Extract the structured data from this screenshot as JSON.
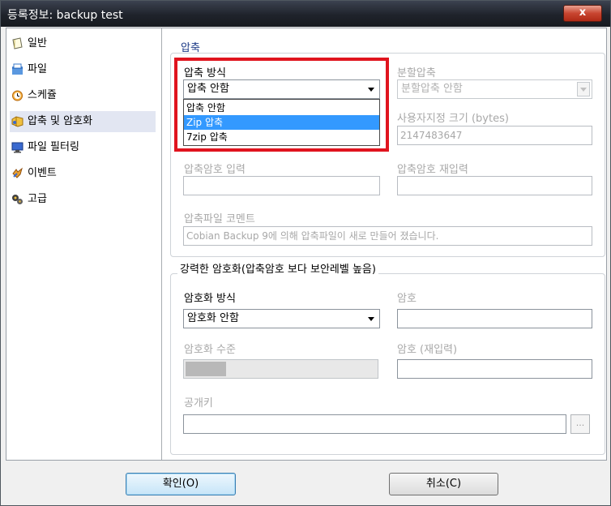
{
  "window": {
    "title": "등록정보: backup test",
    "close_label": "x"
  },
  "sidebar": {
    "items": [
      {
        "label": "일반",
        "icon": "general-page-icon"
      },
      {
        "label": "파일",
        "icon": "file-icon"
      },
      {
        "label": "스케쥴",
        "icon": "clock-icon"
      },
      {
        "label": "압축 및 암호화",
        "icon": "compression-icon",
        "selected": true
      },
      {
        "label": "파일 필터링",
        "icon": "monitor-icon"
      },
      {
        "label": "이벤트",
        "icon": "event-icon"
      },
      {
        "label": "고급",
        "icon": "advanced-icon"
      }
    ]
  },
  "compression": {
    "group_label": "압축",
    "method_label": "압축 방식",
    "method_value": "압축 안함",
    "method_options": [
      "압축 안함",
      "Zip 압축",
      "7zip 압축"
    ],
    "highlighted_option": "Zip 압축",
    "split_label": "분할압축",
    "split_value": "분할압축 안함",
    "custom_size_label": "사용자지정 크기 (bytes)",
    "custom_size_value": "2147483647",
    "password_label": "압축암호 입력",
    "password_confirm_label": "압축암호 재입력",
    "comment_label": "압축파일 코멘트",
    "comment_value": "Cobian Backup 9에 의해 압축파일이 새로 만들어 졌습니다."
  },
  "encryption": {
    "group_label": "강력한 암호화(압축암호 보다 보안레벨 높음)",
    "method_label": "암호화 방식",
    "method_value": "암호화 안함",
    "password_label": "암호",
    "level_label": "암호화 수준",
    "password_confirm_label": "암호 (재입력)",
    "public_key_label": "공개키",
    "browse_label": "..."
  },
  "footer": {
    "ok_label": "확인(O)",
    "cancel_label": "취소(C)"
  },
  "colors": {
    "highlight": "#e0141e",
    "selection": "#3399ff"
  }
}
